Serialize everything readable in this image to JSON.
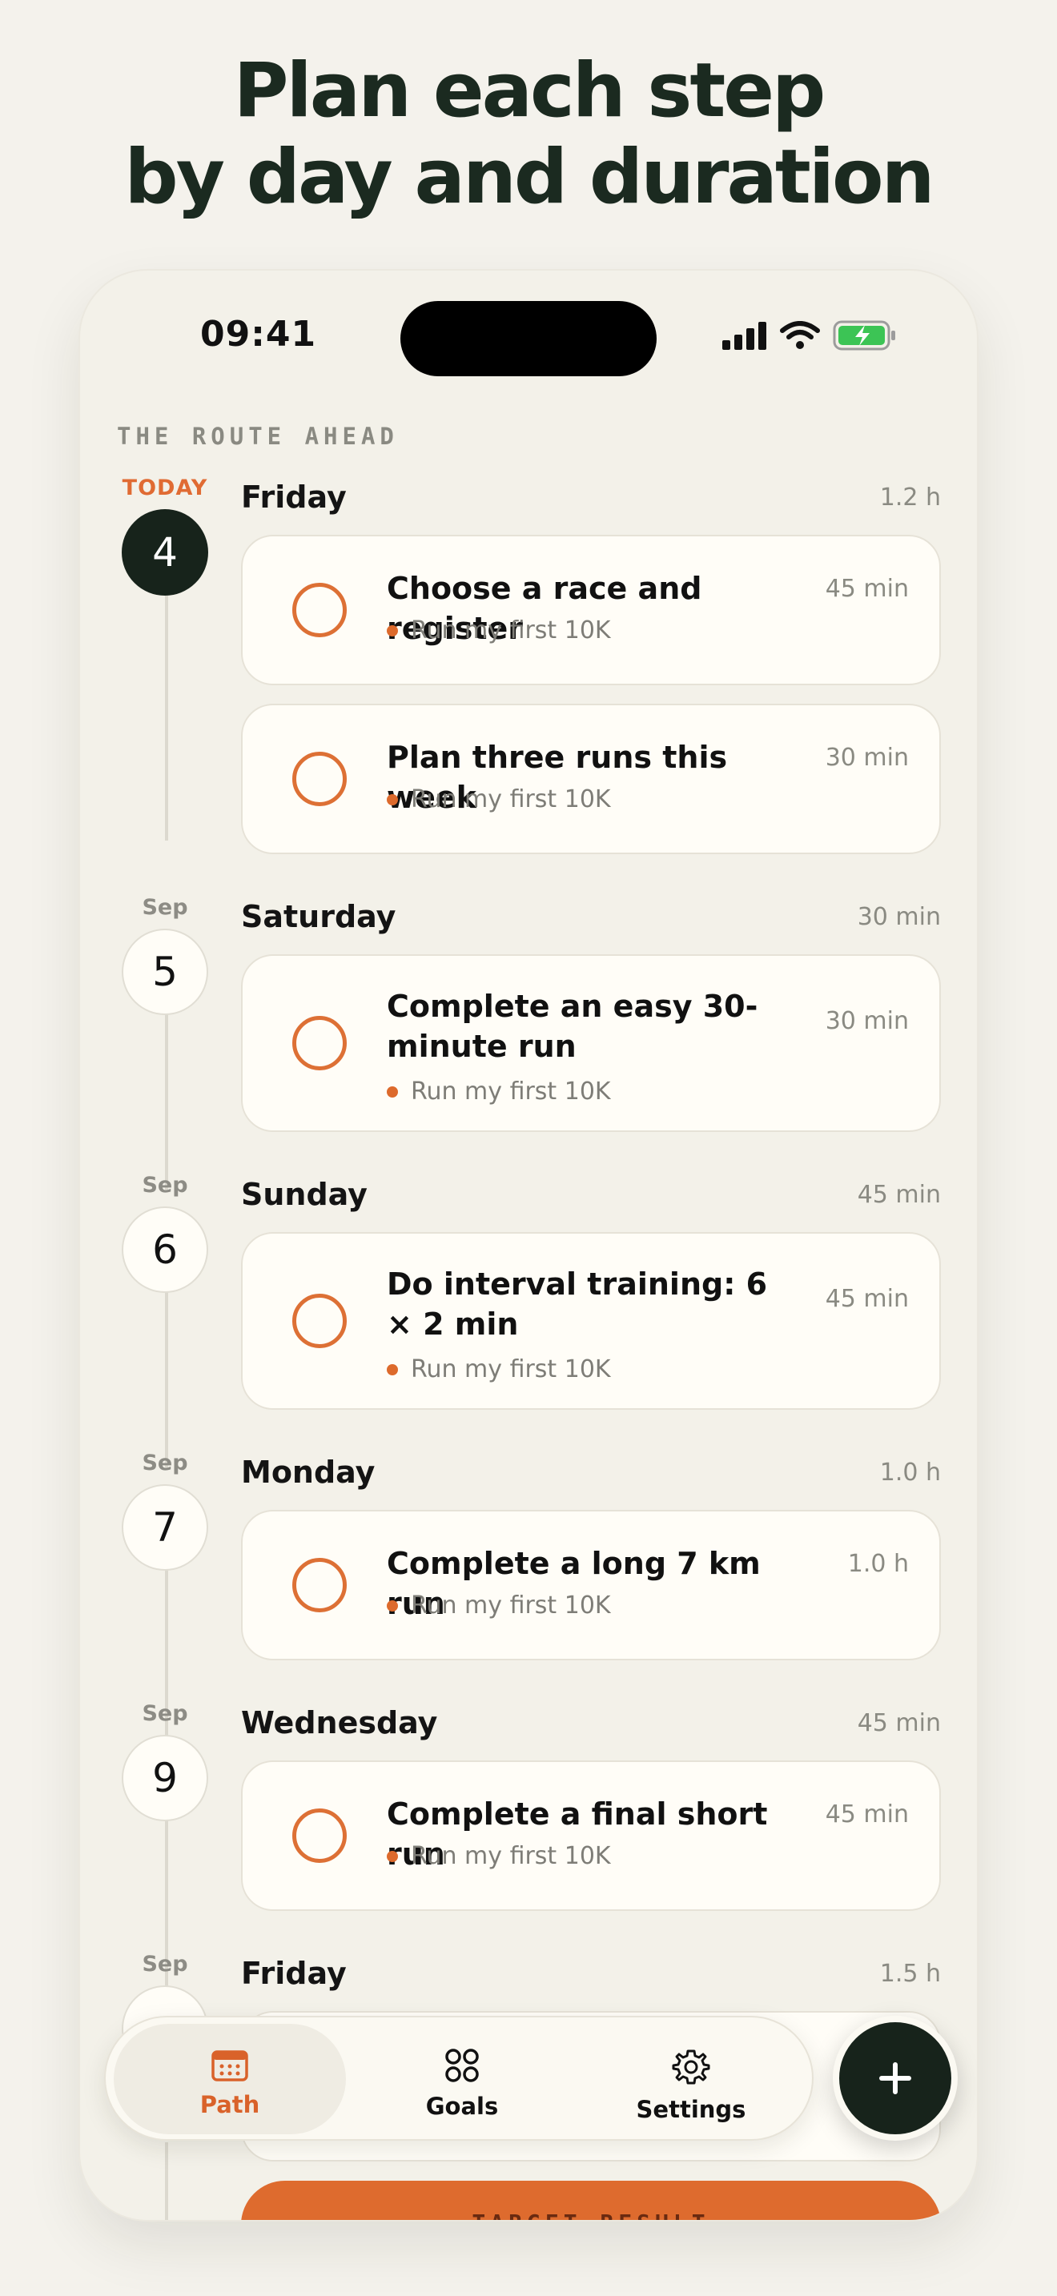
{
  "headline": {
    "line1": "Plan each step",
    "line2": "by day and duration"
  },
  "status_bar": {
    "time": "09:41",
    "icons": [
      "cellular-signal-icon",
      "wifi-icon",
      "battery-charging-icon"
    ]
  },
  "section_label": "THE ROUTE AHEAD",
  "colors": {
    "accent": "#dd6a2c",
    "dark": "#17231b",
    "background": "#f3f1e9",
    "card": "#fffdf7"
  },
  "days": [
    {
      "tag": "TODAY",
      "date": "4",
      "name": "Friday",
      "total": "1.2 h",
      "today": true,
      "tasks": [
        {
          "title": "Choose a race and register",
          "goal": "Run my first 10K",
          "duration": "45 min"
        },
        {
          "title": "Plan three runs this week",
          "goal": "Run my first 10K",
          "duration": "30 min"
        }
      ]
    },
    {
      "tag": "Sep",
      "date": "5",
      "name": "Saturday",
      "total": "30 min",
      "tasks": [
        {
          "title": "Complete an easy 30-minute run",
          "goal": "Run my first 10K",
          "duration": "30 min"
        }
      ]
    },
    {
      "tag": "Sep",
      "date": "6",
      "name": "Sunday",
      "total": "45 min",
      "tasks": [
        {
          "title": "Do interval training: 6 × 2 min",
          "goal": "Run my first 10K",
          "duration": "45 min"
        }
      ]
    },
    {
      "tag": "Sep",
      "date": "7",
      "name": "Monday",
      "total": "1.0 h",
      "tasks": [
        {
          "title": "Complete a long 7 km run",
          "goal": "Run my first 10K",
          "duration": "1.0 h"
        }
      ]
    },
    {
      "tag": "Sep",
      "date": "9",
      "name": "Wednesday",
      "total": "45 min",
      "tasks": [
        {
          "title": "Complete a final short run",
          "goal": "Run my first 10K",
          "duration": "45 min"
        }
      ]
    },
    {
      "tag": "Sep",
      "date": "",
      "name": "Friday",
      "total": "1.5 h",
      "tasks": []
    }
  ],
  "cta_label": "TARGET RESULT",
  "tabbar": {
    "path": "Path",
    "goals": "Goals",
    "settings": "Settings"
  },
  "fab_icon": "plus-icon"
}
